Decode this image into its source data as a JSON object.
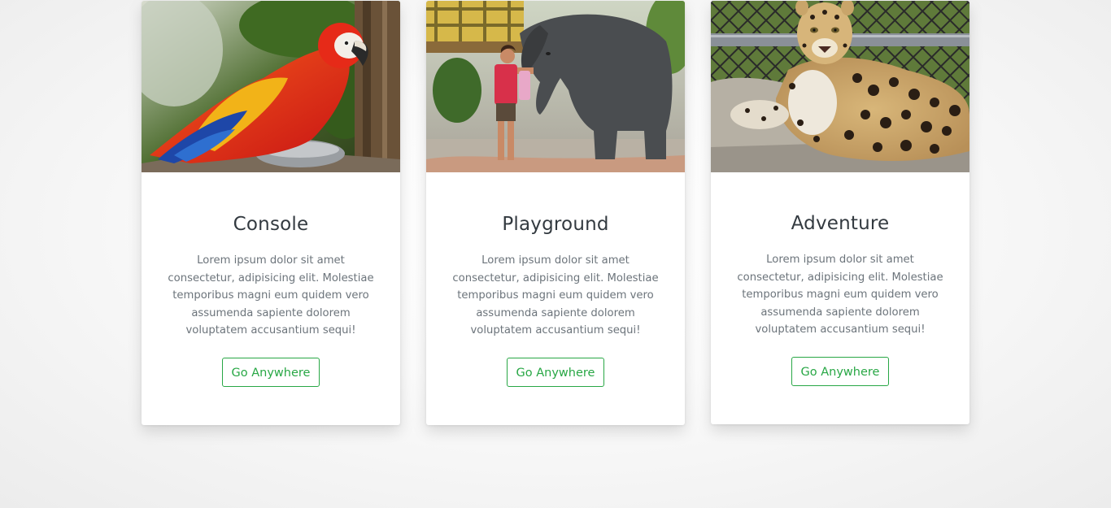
{
  "cards": [
    {
      "image": "scarlet-macaw-photo",
      "title": "Console",
      "text": "Lorem ipsum dolor sit amet consectetur, adipisicing elit. Molestiae temporibus magni eum quidem vero assumenda sapiente dolorem voluptatem accusantium sequi!",
      "button_label": "Go Anywhere"
    },
    {
      "image": "elephant-photo",
      "title": "Playground",
      "text": "Lorem ipsum dolor sit amet consectetur, adipisicing elit. Molestiae temporibus magni eum quidem vero assumenda sapiente dolorem voluptatem accusantium sequi!",
      "button_label": "Go Anywhere"
    },
    {
      "image": "leopard-photo",
      "title": "Adventure",
      "text": "Lorem ipsum dolor sit amet consectetur, adipisicing elit. Molestiae temporibus magni eum quidem vero assumenda sapiente dolorem voluptatem accusantium sequi!",
      "button_label": "Go Anywhere"
    }
  ],
  "colors": {
    "button_accent": "#28a745",
    "title_text": "#333a40",
    "body_text": "#6c747b"
  }
}
